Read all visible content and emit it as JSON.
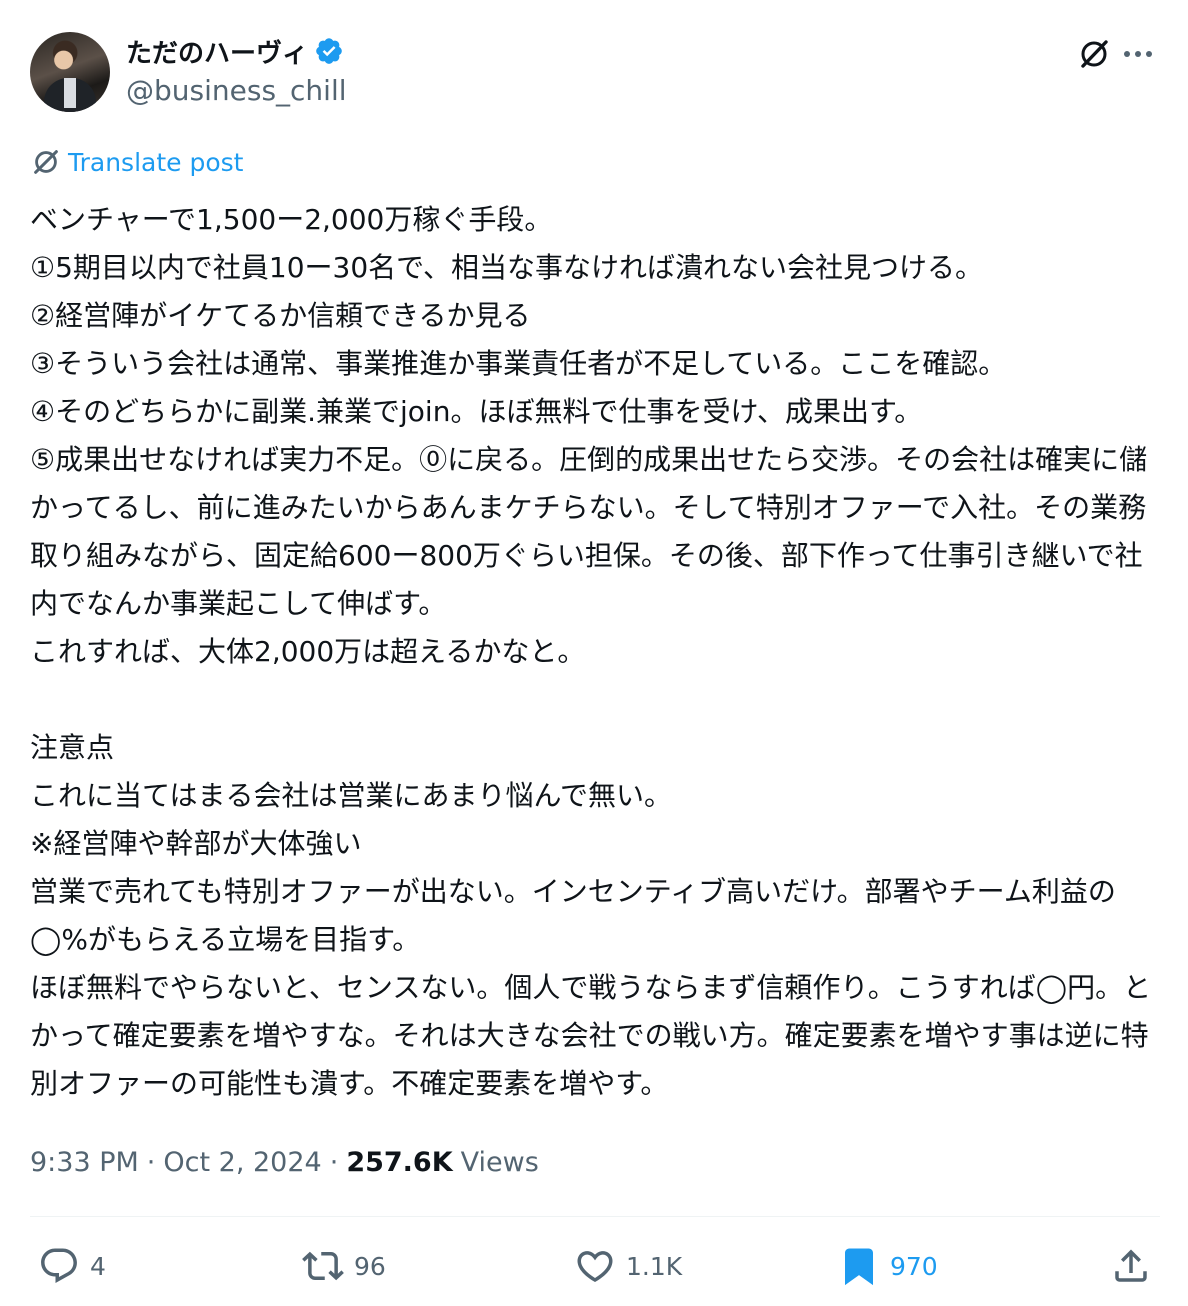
{
  "author": {
    "display_name": "ただのハーヴィ",
    "handle": "@business_chill",
    "verified": true
  },
  "header_icons": [
    "grok-icon",
    "more-icon"
  ],
  "translate_label": "Translate post",
  "post_text": "ベンチャーで1,500ー2,000万稼ぐ手段。\n①5期目以内で社員10ー30名で、相当な事なければ潰れない会社見つける。\n②経営陣がイケてるか信頼できるか見る\n③そういう会社は通常、事業推進か事業責任者が不足している。ここを確認。\n④そのどちらかに副業.兼業でjoin。ほぼ無料で仕事を受け、成果出す。\n⑤成果出せなければ実力不足。⓪に戻る。圧倒的成果出せたら交渉。その会社は確実に儲かってるし、前に進みたいからあんまケチらない。そして特別オファーで入社。その業務取り組みながら、固定給600ー800万ぐらい担保。その後、部下作って仕事引き継いで社内でなんか事業起こして伸ばす。\nこれすれば、大体2,000万は超えるかなと。\n\n注意点\nこれに当てはまる会社は営業にあまり悩んで無い。\n※経営陣や幹部が大体強い\n営業で売れても特別オファーが出ない。インセンティブ高いだけ。部署やチーム利益の◯%がもらえる立場を目指す。\nほぼ無料でやらないと、センスない。個人で戦うならまず信頼作り。こうすれば◯円。とかって確定要素を増やすな。それは大きな会社での戦い方。確定要素を増やす事は逆に特別オファーの可能性も潰す。不確定要素を増やす。",
  "meta": {
    "time": "9:33 PM",
    "date": "Oct 2, 2024",
    "views_count": "257.6K",
    "views_label": "Views",
    "sep": "·"
  },
  "actions": {
    "replies": "4",
    "reposts": "96",
    "likes": "1.1K",
    "bookmarks": "970"
  },
  "colors": {
    "text": "#0f1419",
    "secondary": "#536471",
    "accent": "#1d9bf0",
    "divider": "#eff3f4"
  }
}
